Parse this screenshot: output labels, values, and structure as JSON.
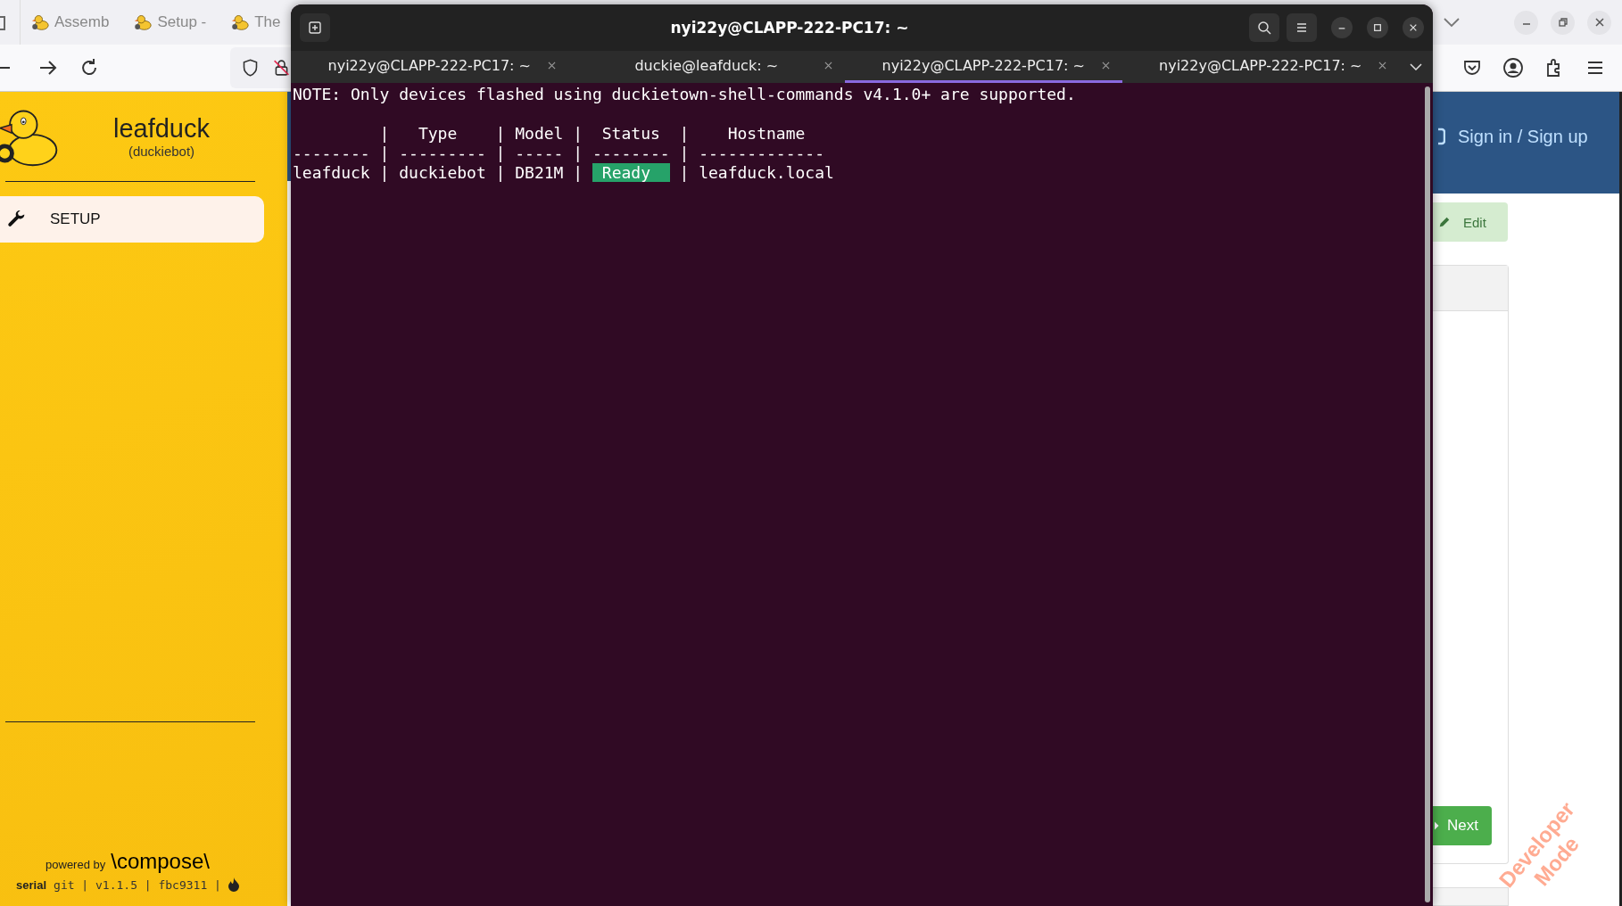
{
  "browser": {
    "tabs": [
      {
        "label": "Assemb",
        "selected": false
      },
      {
        "label": "Setup -",
        "selected": false
      },
      {
        "label": "The",
        "selected": false
      }
    ]
  },
  "sidebar": {
    "robot_name": "leafduck",
    "robot_type": "(duckiebot)",
    "nav": [
      {
        "label": "SETUP",
        "selected": true
      }
    ],
    "footer": {
      "powered_by": "powered by",
      "brand": "\\compose\\",
      "label": "serial",
      "version_line": "git | v1.1.5 | fbc9311 |"
    }
  },
  "page": {
    "header_link": "Sign in / Sign up",
    "edit_button": "Edit",
    "next_button": "Next",
    "badge": "Developer Mode"
  },
  "terminal": {
    "title": "nyi22y@CLAPP-222-PC17: ~",
    "tabs": [
      {
        "label": "nyi22y@CLAPP-222-PC17: ~",
        "selected": false
      },
      {
        "label": "duckie@leafduck: ~",
        "selected": false
      },
      {
        "label": "nyi22y@CLAPP-222-PC17: ~",
        "selected": true
      },
      {
        "label": "nyi22y@CLAPP-222-PC17: ~",
        "selected": false
      }
    ],
    "note": "NOTE: Only devices flashed using duckietown-shell-commands v4.1.0+ are supported.",
    "table_lines": [
      {
        "segments": [
          {
            "text": "         |   Type    | Model |  Status  |    Hostname",
            "highlight": false
          }
        ]
      },
      {
        "segments": [
          {
            "text": "-------- | --------- | ----- | -------- | -------------",
            "highlight": false
          }
        ]
      },
      {
        "segments": [
          {
            "text": "leafduck | duckiebot | DB21M | ",
            "highlight": false
          },
          {
            "text": " Ready  ",
            "highlight": true
          },
          {
            "text": " | leafduck.local",
            "highlight": false
          }
        ]
      }
    ]
  }
}
